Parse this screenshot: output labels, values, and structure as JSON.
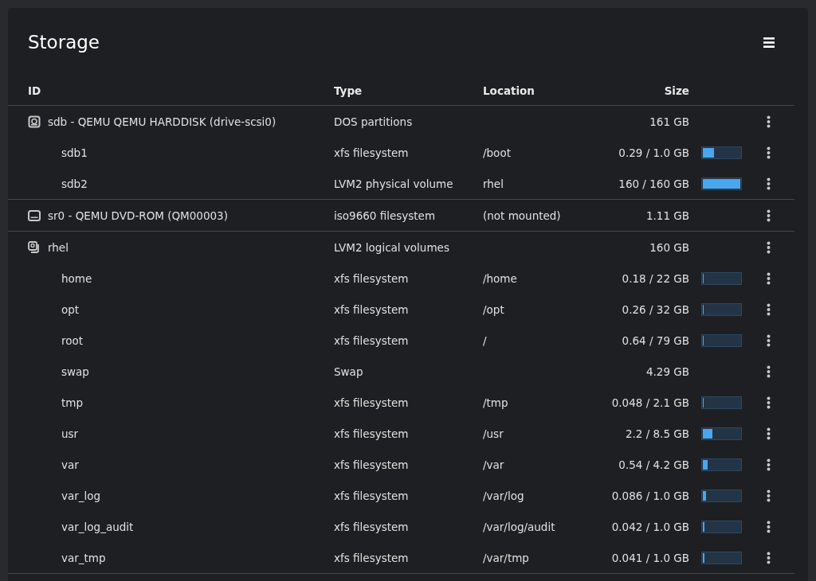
{
  "title": "Storage",
  "columns": [
    "ID",
    "Type",
    "Location",
    "Size"
  ],
  "rows": [
    {
      "kind": "disk",
      "id": "sdb - QEMU QEMU HARDDISK (drive-scsi0)",
      "type": "DOS partitions",
      "size": "161 GB",
      "children": [
        {
          "id": "sdb1",
          "type": "xfs filesystem",
          "location": "/boot",
          "size": "0.29 / 1.0 GB",
          "level": 0.29
        },
        {
          "id": "sdb2",
          "type": "LVM2 physical volume",
          "location": "rhel",
          "size": "160 / 160 GB",
          "level": 1.0
        }
      ]
    },
    {
      "kind": "optical",
      "id": "sr0 - QEMU DVD-ROM (QM00003)",
      "type": "iso9660 filesystem",
      "location": "(not mounted)",
      "size": "1.11 GB"
    },
    {
      "kind": "volume-group",
      "id": "rhel",
      "type": "LVM2 logical volumes",
      "size": "160 GB",
      "children": [
        {
          "id": "home",
          "type": "xfs filesystem",
          "location": "/home",
          "size": "0.18 / 22 GB",
          "level": 0.008
        },
        {
          "id": "opt",
          "type": "xfs filesystem",
          "location": "/opt",
          "size": "0.26 / 32 GB",
          "level": 0.008
        },
        {
          "id": "root",
          "type": "xfs filesystem",
          "location": "/",
          "size": "0.64 / 79 GB",
          "level": 0.008
        },
        {
          "id": "swap",
          "type": "Swap",
          "size": "4.29 GB"
        },
        {
          "id": "tmp",
          "type": "xfs filesystem",
          "location": "/tmp",
          "size": "0.048 / 2.1 GB",
          "level": 0.023
        },
        {
          "id": "usr",
          "type": "xfs filesystem",
          "location": "/usr",
          "size": "2.2 / 8.5 GB",
          "level": 0.26
        },
        {
          "id": "var",
          "type": "xfs filesystem",
          "location": "/var",
          "size": "0.54 / 4.2 GB",
          "level": 0.13
        },
        {
          "id": "var_log",
          "type": "xfs filesystem",
          "location": "/var/log",
          "size": "0.086 / 1.0 GB",
          "level": 0.086
        },
        {
          "id": "var_log_audit",
          "type": "xfs filesystem",
          "location": "/var/log/audit",
          "size": "0.042 / 1.0 GB",
          "level": 0.042
        },
        {
          "id": "var_tmp",
          "type": "xfs filesystem",
          "location": "/var/tmp",
          "size": "0.041 / 1.0 GB",
          "level": 0.041
        }
      ]
    }
  ]
}
